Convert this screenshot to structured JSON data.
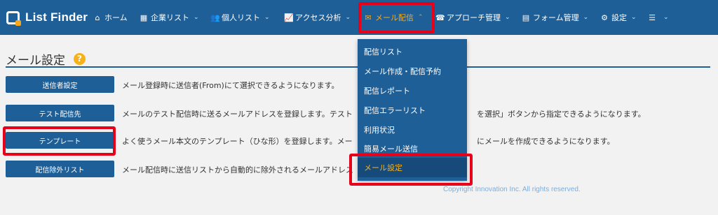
{
  "brand": {
    "name": "List Finder"
  },
  "nav": {
    "items": [
      {
        "icon": "home-icon",
        "glyph": "⌂",
        "label": "ホーム",
        "has_menu": false
      },
      {
        "icon": "building-icon",
        "glyph": "▦",
        "label": "企業リスト",
        "has_menu": true
      },
      {
        "icon": "users-icon",
        "glyph": "👥",
        "label": "個人リスト",
        "has_menu": true
      },
      {
        "icon": "chart-line-icon",
        "glyph": "📈",
        "label": "アクセス分析",
        "has_menu": true
      },
      {
        "icon": "envelope-icon",
        "glyph": "✉",
        "label": "メール配信",
        "has_menu": true,
        "active": true
      },
      {
        "icon": "phone-icon",
        "glyph": "☎",
        "label": "アプローチ管理",
        "has_menu": true
      },
      {
        "icon": "form-icon",
        "glyph": "▤",
        "label": "フォーム管理",
        "has_menu": true
      },
      {
        "icon": "gear-icon",
        "glyph": "⚙",
        "label": "設定",
        "has_menu": true
      },
      {
        "icon": "menu-icon",
        "glyph": "☰",
        "label": "",
        "has_menu": true
      }
    ],
    "chevron_closed": "⌄",
    "chevron_open": "⌃"
  },
  "page": {
    "title": "メール設定",
    "help_glyph": "?"
  },
  "settings": [
    {
      "button": "送信者設定",
      "description": "メール登録時に送信者(From)にて選択できるようになります。"
    },
    {
      "button": "テスト配信先",
      "description": "メールのテスト配信時に送るメールアドレスを登録します。テスト"
    },
    {
      "button": "テンプレート",
      "description": "よく使うメール本文のテンプレート（ひな形）を登録します。メー"
    },
    {
      "button": "配信除外リスト",
      "description": "メール配信時に送信リストから自動的に除外されるメールアドレス"
    }
  ],
  "settings_tail": [
    "",
    "を選択」ボタンから指定できるようになります。",
    "にメールを作成できるようになります。",
    ""
  ],
  "dropdown": {
    "items": [
      {
        "label": "配信リスト"
      },
      {
        "label": "メール作成・配信予約"
      },
      {
        "label": "配信レポート"
      },
      {
        "label": "配信エラーリスト"
      },
      {
        "label": "利用状況"
      },
      {
        "label": "簡易メール送信"
      },
      {
        "label": "メール設定",
        "selected": true
      }
    ]
  },
  "footer": {
    "copyright": "Copyright Innovation Inc. All rights reserved."
  },
  "colors": {
    "nav_bg": "#1f5f97",
    "accent": "#f5a81c",
    "highlight": "#e8001a"
  }
}
